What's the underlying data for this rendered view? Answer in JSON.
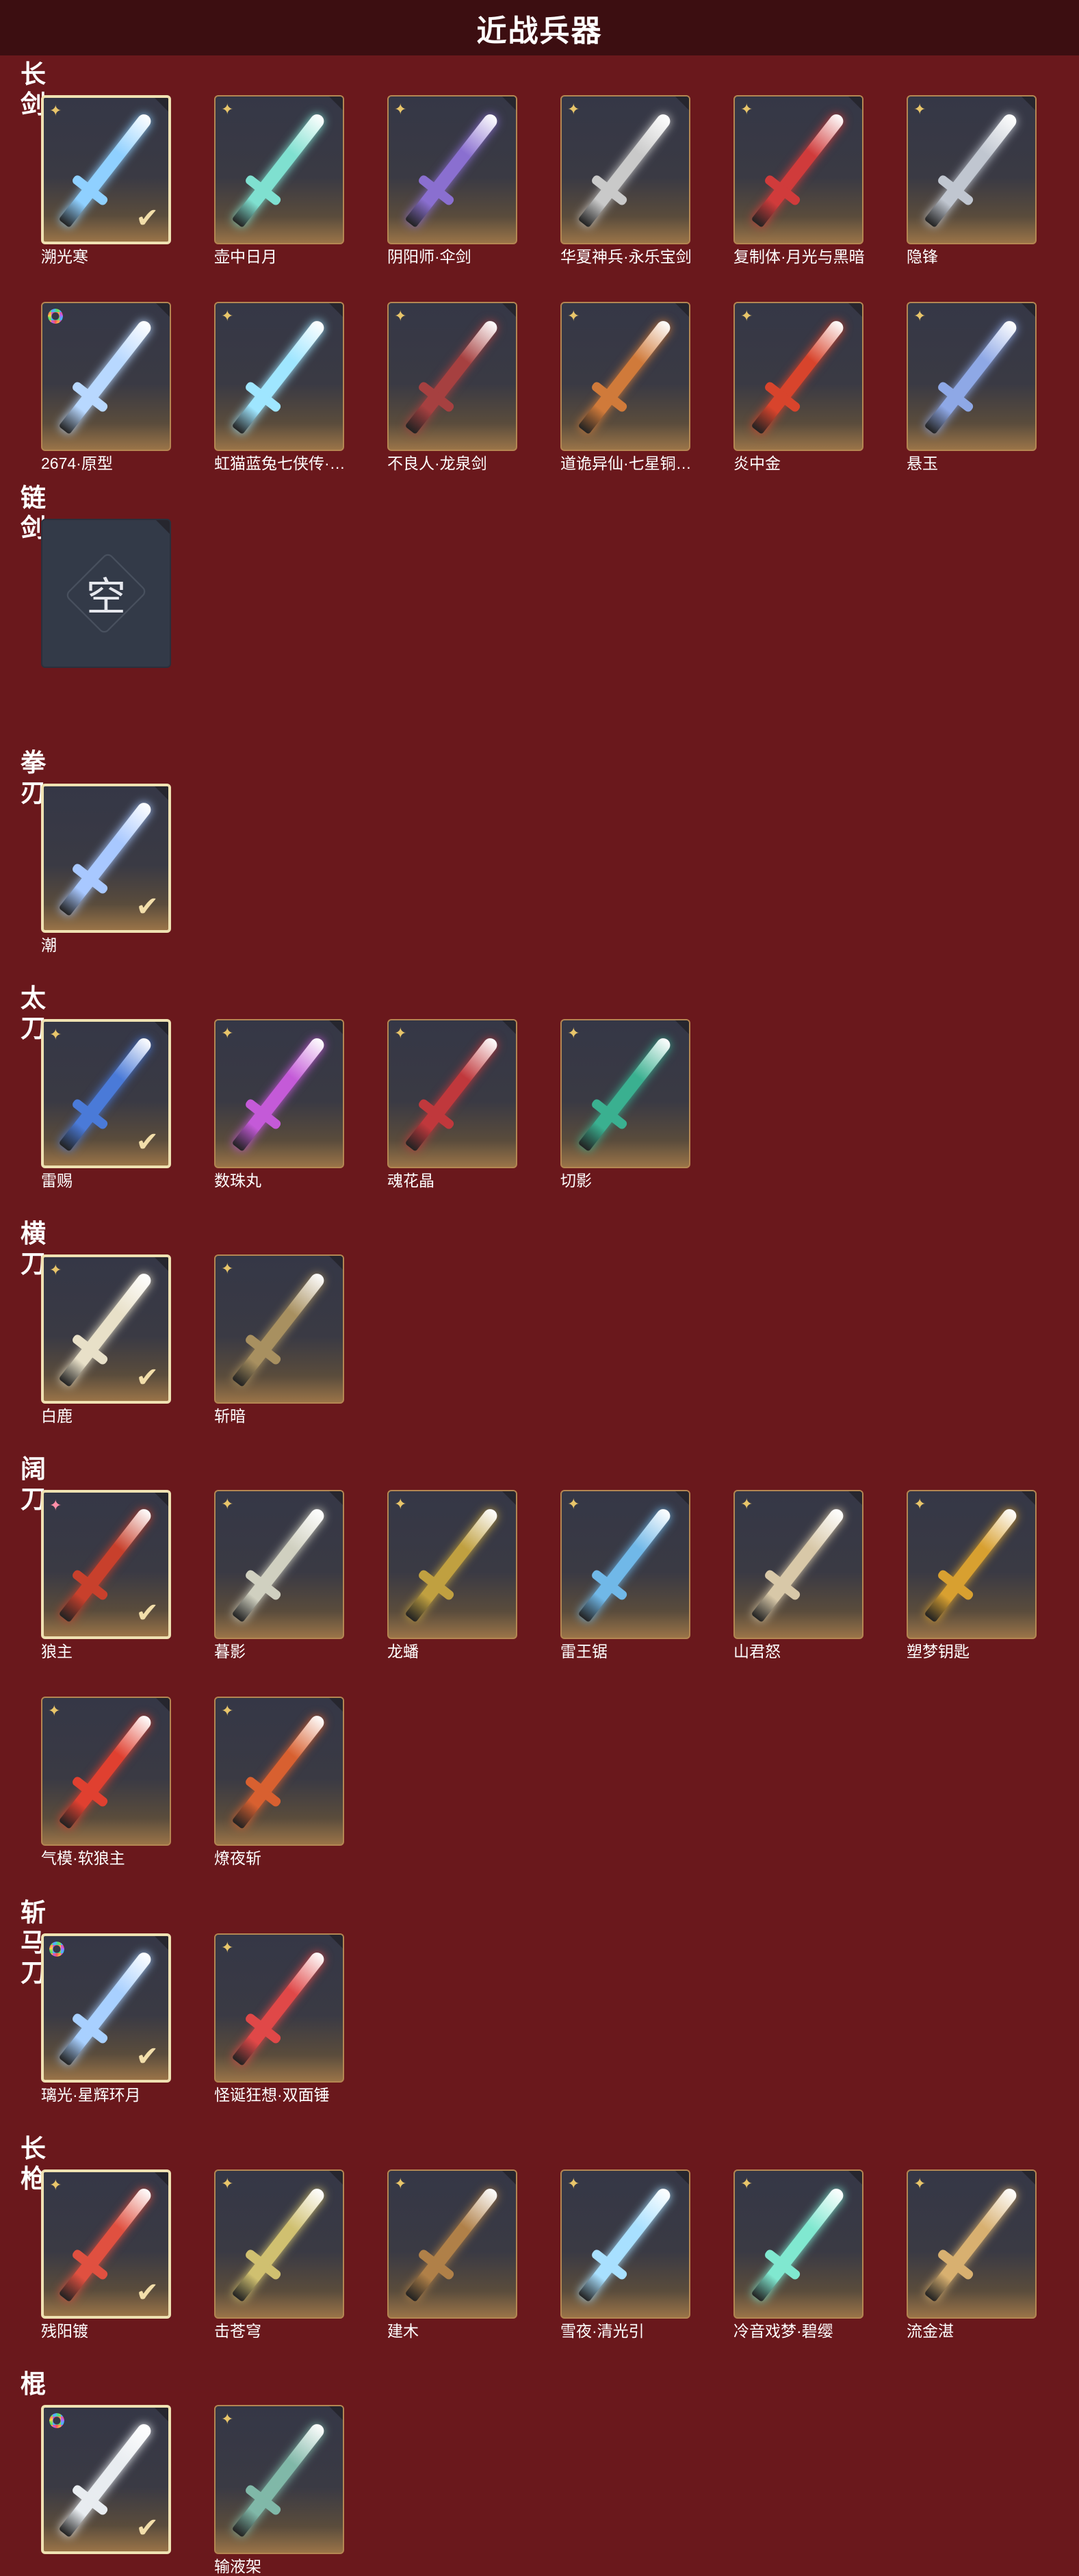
{
  "page": {
    "title": "近战兵器"
  },
  "sections": [
    {
      "title": "长剑",
      "items": [
        {
          "name": "溯光寒",
          "rarity": "gold",
          "equipped": true,
          "color": "#8fd0ff"
        },
        {
          "name": "壶中日月",
          "rarity": "gold",
          "equipped": false,
          "color": "#7fe0d0"
        },
        {
          "name": "阴阳师·伞剑",
          "rarity": "gold",
          "equipped": false,
          "color": "#8a6fd0"
        },
        {
          "name": "华夏神兵·永乐宝剑",
          "rarity": "gold",
          "equipped": false,
          "color": "#c9c9c9"
        },
        {
          "name": "复制体·月光与黑暗",
          "rarity": "gold",
          "equipped": false,
          "color": "#d03b3b"
        },
        {
          "name": "隐锋",
          "rarity": "gold",
          "equipped": false,
          "color": "#c0c6d0"
        },
        {
          "name": "2674·原型",
          "rarity": "ring",
          "equipped": false,
          "color": "#b8d8ff"
        },
        {
          "name": "虹猫蓝兔七侠传·冰魄…",
          "rarity": "gold",
          "equipped": false,
          "color": "#9fe6ff"
        },
        {
          "name": "不良人·龙泉剑",
          "rarity": "gold",
          "equipped": false,
          "color": "#a64040"
        },
        {
          "name": "道诡异仙·七星铜钱剑",
          "rarity": "gold",
          "equipped": false,
          "color": "#d07a3a"
        },
        {
          "name": "炎中金",
          "rarity": "gold",
          "equipped": false,
          "color": "#d8442c"
        },
        {
          "name": "悬玉",
          "rarity": "gold",
          "equipped": false,
          "color": "#8ea8e6"
        }
      ]
    },
    {
      "title": "链剑",
      "items": [
        {
          "name": "",
          "rarity": "none",
          "equipped": false,
          "empty": true,
          "empty_char": "空"
        }
      ]
    },
    {
      "title": "拳刃",
      "items": [
        {
          "name": "潮",
          "rarity": "none",
          "equipped": true,
          "color": "#a8c8ff"
        }
      ]
    },
    {
      "title": "太刀",
      "items": [
        {
          "name": "雷赐",
          "rarity": "gold",
          "equipped": true,
          "color": "#4a7ad8"
        },
        {
          "name": "数珠丸",
          "rarity": "gold",
          "equipped": false,
          "color": "#c45ad8"
        },
        {
          "name": "魂花晶",
          "rarity": "gold",
          "equipped": false,
          "color": "#c0383c"
        },
        {
          "name": "切影",
          "rarity": "gold",
          "equipped": false,
          "color": "#3ab090"
        }
      ]
    },
    {
      "title": "横刀",
      "items": [
        {
          "name": "白鹿",
          "rarity": "gold",
          "equipped": true,
          "color": "#e8e0c8"
        },
        {
          "name": "斩暗",
          "rarity": "gold",
          "equipped": false,
          "color": "#a89060"
        }
      ]
    },
    {
      "title": "阔刀",
      "items": [
        {
          "name": "狼主",
          "rarity": "pink",
          "equipped": true,
          "color": "#c8402c"
        },
        {
          "name": "暮影",
          "rarity": "gold",
          "equipped": false,
          "color": "#d0d0c0"
        },
        {
          "name": "龙蟠",
          "rarity": "gold",
          "equipped": false,
          "color": "#c0a040"
        },
        {
          "name": "雷王锯",
          "rarity": "gold",
          "equipped": false,
          "color": "#70b8e8"
        },
        {
          "name": "山君怒",
          "rarity": "gold",
          "equipped": false,
          "color": "#d8c8a8"
        },
        {
          "name": "塑梦钥匙",
          "rarity": "gold",
          "equipped": false,
          "color": "#d8a030"
        },
        {
          "name": "气模·软狼主",
          "rarity": "gold",
          "equipped": false,
          "color": "#e04030"
        },
        {
          "name": "燎夜斩",
          "rarity": "gold",
          "equipped": false,
          "color": "#d86030"
        }
      ]
    },
    {
      "title": "斩马刀",
      "items": [
        {
          "name": "璃光·星辉环月",
          "rarity": "ring",
          "equipped": true,
          "color": "#a8d0ff"
        },
        {
          "name": "怪诞狂想·双面锤",
          "rarity": "gold",
          "equipped": false,
          "color": "#e04848"
        }
      ]
    },
    {
      "title": "长枪",
      "items": [
        {
          "name": "残阳镀",
          "rarity": "gold",
          "equipped": true,
          "color": "#e05040"
        },
        {
          "name": "击苍穹",
          "rarity": "gold",
          "equipped": false,
          "color": "#d0c070"
        },
        {
          "name": "建木",
          "rarity": "gold",
          "equipped": false,
          "color": "#b08048"
        },
        {
          "name": "雪夜·清光引",
          "rarity": "gold",
          "equipped": false,
          "color": "#a8e0ff"
        },
        {
          "name": "冷音戏梦·碧缨",
          "rarity": "gold",
          "equipped": false,
          "color": "#80e8d0"
        },
        {
          "name": "流金湛",
          "rarity": "gold",
          "equipped": false,
          "color": "#d8b070"
        }
      ]
    },
    {
      "title": "棍",
      "items": [
        {
          "name": "",
          "rarity": "ring",
          "equipped": true,
          "color": "#e8ecf0"
        },
        {
          "name": "输液架",
          "rarity": "gold",
          "equipped": false,
          "color": "#80b8a8"
        }
      ]
    }
  ]
}
